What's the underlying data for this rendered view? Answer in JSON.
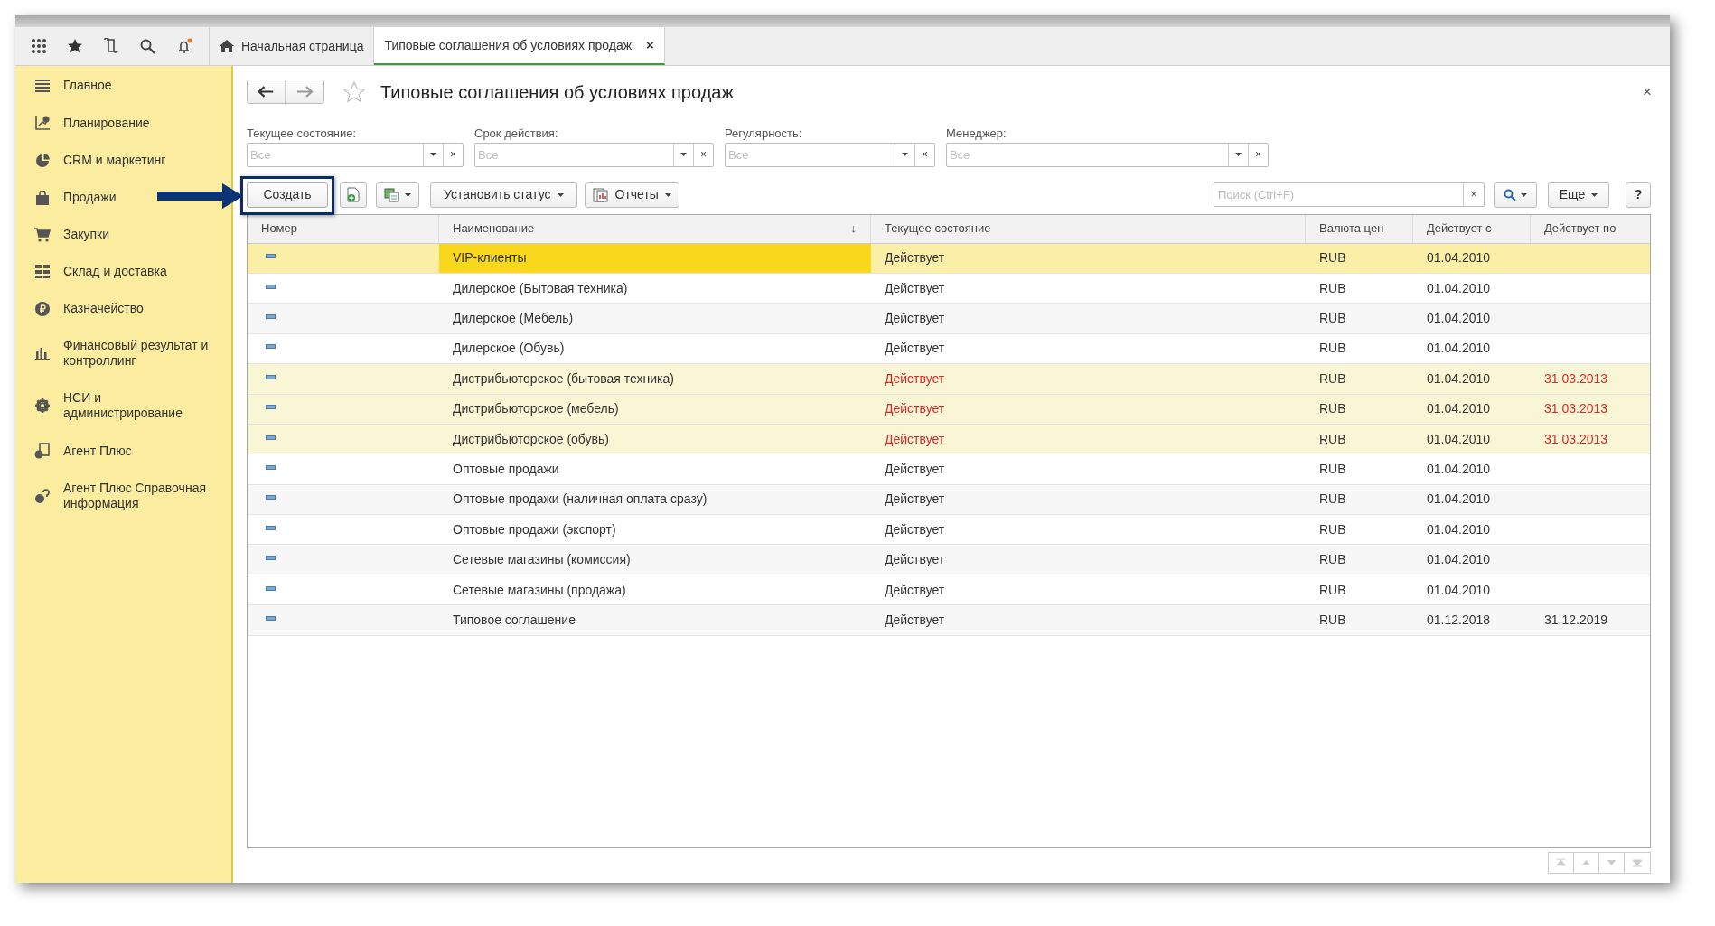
{
  "top_bar": {
    "notification_dot": true
  },
  "tabs": [
    {
      "label": "Начальная страница",
      "kind": "home",
      "selected": false
    },
    {
      "label": "Типовые соглашения об условиях продаж",
      "kind": "page",
      "selected": true,
      "close": "×"
    }
  ],
  "sidebar": {
    "items": [
      {
        "label": "Главное"
      },
      {
        "label": "Планирование"
      },
      {
        "label": "CRM и маркетинг"
      },
      {
        "label": "Продажи"
      },
      {
        "label": "Закупки"
      },
      {
        "label": "Склад и доставка"
      },
      {
        "label": "Казначейство"
      },
      {
        "label": "Финансовый результат и контроллинг"
      },
      {
        "label": "НСИ и администрирование"
      },
      {
        "label": "Агент Плюс"
      },
      {
        "label": "Агент Плюс Справочная информация"
      }
    ]
  },
  "form": {
    "title": "Типовые соглашения об условиях продаж",
    "close": "×",
    "filters": [
      {
        "label": "Текущее состояние:",
        "placeholder": "Все",
        "clear": "×"
      },
      {
        "label": "Срок действия:",
        "placeholder": "Все",
        "clear": "×"
      },
      {
        "label": "Регулярность:",
        "placeholder": "Все",
        "clear": "×"
      },
      {
        "label": "Менеджер:",
        "placeholder": "Все",
        "clear": "×"
      }
    ],
    "toolbar": {
      "create": "Создать",
      "set_status": "Установить статус",
      "reports": "Отчеты",
      "search_placeholder": "Поиск (Ctrl+F)",
      "search_clear": "×",
      "more": "Еще",
      "help": "?"
    },
    "table": {
      "columns": [
        {
          "label": "Номер"
        },
        {
          "label": "Наименование",
          "sort_mark": "↓"
        },
        {
          "label": "Текущее состояние"
        },
        {
          "label": "Валюта цен"
        },
        {
          "label": "Действует с"
        },
        {
          "label": "Действует по"
        }
      ],
      "rows": [
        {
          "name": "VIP-клиенты",
          "status": "Действует",
          "currency": "RUB",
          "from": "01.04.2010",
          "to": "",
          "selected": true,
          "expired": false
        },
        {
          "name": "Дилерское (Бытовая техника)",
          "status": "Действует",
          "currency": "RUB",
          "from": "01.04.2010",
          "to": "",
          "selected": false,
          "expired": false
        },
        {
          "name": "Дилерское (Мебель)",
          "status": "Действует",
          "currency": "RUB",
          "from": "01.04.2010",
          "to": "",
          "selected": false,
          "expired": false
        },
        {
          "name": "Дилерское (Обувь)",
          "status": "Действует",
          "currency": "RUB",
          "from": "01.04.2010",
          "to": "",
          "selected": false,
          "expired": false
        },
        {
          "name": "Дистрибьюторское (бытовая техника)",
          "status": "Действует",
          "currency": "RUB",
          "from": "01.04.2010",
          "to": "31.03.2013",
          "selected": false,
          "expired": true
        },
        {
          "name": "Дистрибьюторское (мебель)",
          "status": "Действует",
          "currency": "RUB",
          "from": "01.04.2010",
          "to": "31.03.2013",
          "selected": false,
          "expired": true
        },
        {
          "name": "Дистрибьюторское (обувь)",
          "status": "Действует",
          "currency": "RUB",
          "from": "01.04.2010",
          "to": "31.03.2013",
          "selected": false,
          "expired": true
        },
        {
          "name": "Оптовые продажи",
          "status": "Действует",
          "currency": "RUB",
          "from": "01.04.2010",
          "to": "",
          "selected": false,
          "expired": false
        },
        {
          "name": "Оптовые продажи (наличная оплата сразу)",
          "status": "Действует",
          "currency": "RUB",
          "from": "01.04.2010",
          "to": "",
          "selected": false,
          "expired": false
        },
        {
          "name": "Оптовые продажи (экспорт)",
          "status": "Действует",
          "currency": "RUB",
          "from": "01.04.2010",
          "to": "",
          "selected": false,
          "expired": false
        },
        {
          "name": "Сетевые магазины (комиссия)",
          "status": "Действует",
          "currency": "RUB",
          "from": "01.04.2010",
          "to": "",
          "selected": false,
          "expired": false
        },
        {
          "name": "Сетевые магазины (продажа)",
          "status": "Действует",
          "currency": "RUB",
          "from": "01.04.2010",
          "to": "",
          "selected": false,
          "expired": false
        },
        {
          "name": "Типовое соглашение",
          "status": "Действует",
          "currency": "RUB",
          "from": "01.12.2018",
          "to": "31.12.2019",
          "selected": false,
          "expired": false
        }
      ]
    }
  }
}
